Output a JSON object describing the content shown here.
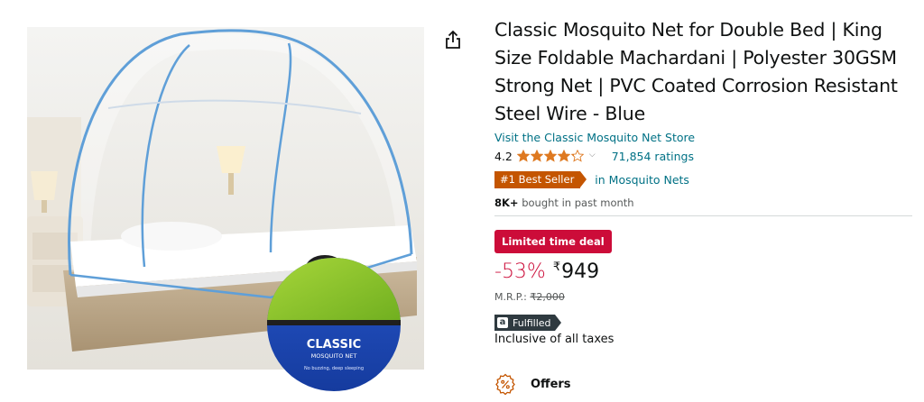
{
  "product": {
    "title": "Classic Mosquito Net for Double Bed | King Size Foldable Machardani | Polyester 30GSM Strong Net | PVC Coated Corrosion Resistant Steel Wire - Blue",
    "store_link": "Visit the Classic Mosquito Net Store",
    "rating_value": "4.2",
    "rating_stars": 4.2,
    "ratings_count": "71,854 ratings",
    "best_seller_badge": "#1 Best Seller",
    "best_seller_category": "in Mosquito Nets",
    "bought_count": "8K+",
    "bought_text": " bought in past month",
    "deal_badge": "Limited time deal",
    "discount": "-53%",
    "currency_symbol": "₹",
    "price": "949",
    "mrp_label": "M.R.P.: ",
    "mrp_value": "₹2,000",
    "fulfilled_label": "Fulfilled",
    "fulfilled_logo": "a",
    "taxes_note": "Inclusive of all taxes",
    "offers_title": "Offers"
  },
  "image": {
    "bag_brand": "CLASSIC",
    "bag_sub": "MOSQUITO NET",
    "bag_tagline": "No buzzing, deep sleeping"
  },
  "icons": {
    "share": "share-icon",
    "chevron": "chevron-down-icon",
    "offers": "offers-percent-icon"
  },
  "colors": {
    "link": "#007185",
    "star": "#de7921",
    "best_seller": "#c45500",
    "deal": "#cc0c39",
    "fulfilled": "#2f3a40"
  }
}
